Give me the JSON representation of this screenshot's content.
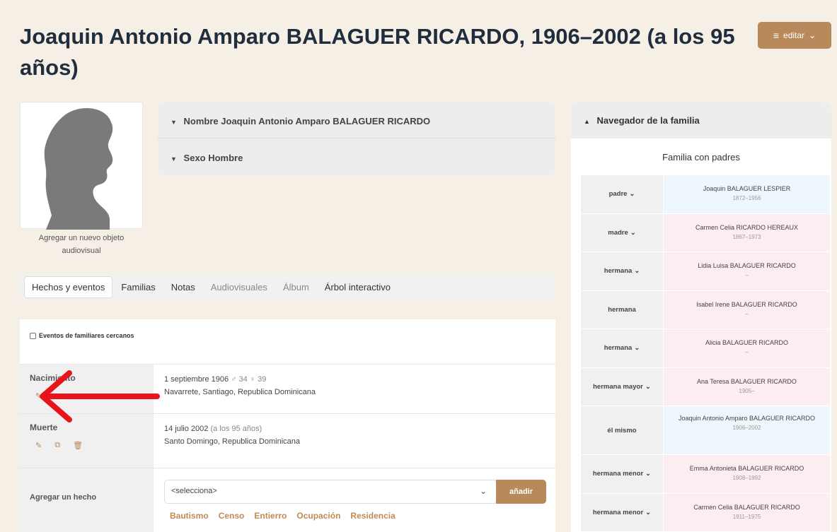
{
  "header": {
    "title": "Joaquin Antonio Amparo BALAGUER RICARDO, 1906–2002 (a los 95 años)",
    "edit_label": "editar",
    "edit_icon": "menu-icon"
  },
  "media": {
    "add_label": "Agregar un nuevo objeto audiovisual"
  },
  "summary": {
    "name_label": "Nombre Joaquin Antonio Amparo BALAGUER RICARDO",
    "sex_label": "Sexo Hombre"
  },
  "tabs": [
    {
      "label": "Hechos y eventos"
    },
    {
      "label": "Familias"
    },
    {
      "label": "Notas"
    },
    {
      "label": "Audiovisuales"
    },
    {
      "label": "Álbum"
    },
    {
      "label": "Árbol interactivo"
    }
  ],
  "facts": {
    "close_relatives_label": "Eventos de familiares cercanos",
    "birth": {
      "label": "Nacimiento",
      "date": "1 septiembre 1906",
      "parents_ages": "♂ 34 ♀ 39",
      "place": "Navarrete, Santiago, Republica Dominicana"
    },
    "death": {
      "label": "Muerte",
      "date": "14 julio 2002",
      "age": "(a los 95 años)",
      "place": "Santo Domingo, Republica Dominicana"
    },
    "add_fact": {
      "label": "Agregar un hecho",
      "select_value": "<selecciona>",
      "button": "añadir",
      "quick": [
        "Bautismo",
        "Censo",
        "Entierro",
        "Ocupación",
        "Residencia"
      ]
    }
  },
  "navigator": {
    "title": "Navegador de la familia",
    "subtitle": "Familia con padres",
    "rows": [
      {
        "rel": "padre",
        "name": "Joaquin BALAGUER LESPIER",
        "years": "1872–1956",
        "sex": "m",
        "menu": true
      },
      {
        "rel": "madre",
        "name": "Carmen Celia RICARDO HEREAUX",
        "years": "1867–1973",
        "sex": "f",
        "menu": true
      },
      {
        "rel": "hermana",
        "name": "Lidia Luisa BALAGUER RICARDO",
        "years": "–",
        "sex": "f",
        "menu": true
      },
      {
        "rel": "hermana",
        "name": "Isabel Irene BALAGUER RICARDO",
        "years": "–",
        "sex": "f",
        "menu": false
      },
      {
        "rel": "hermana",
        "name": "Alicia BALAGUER RICARDO",
        "years": "–",
        "sex": "f",
        "menu": true
      },
      {
        "rel": "hermana mayor",
        "name": "Ana Teresa BALAGUER RICARDO",
        "years": "1905–",
        "sex": "f",
        "menu": true
      },
      {
        "rel": "él mismo",
        "name": "Joaquin Antonio Amparo BALAGUER RICARDO",
        "years": "1906–2002",
        "sex": "m",
        "menu": false,
        "self": true
      },
      {
        "rel": "hermana menor",
        "name": "Emma Antonieta BALAGUER RICARDO",
        "years": "1908–1992",
        "sex": "f",
        "menu": true
      },
      {
        "rel": "hermana menor",
        "name": "Carmen Celia BALAGUER RICARDO",
        "years": "1911–1975",
        "sex": "f",
        "menu": true
      }
    ]
  },
  "colors": {
    "accent": "#b8895a",
    "arrow": "#e8141b",
    "male_bg": "#eef8fc",
    "female_bg": "#fcedf1"
  }
}
